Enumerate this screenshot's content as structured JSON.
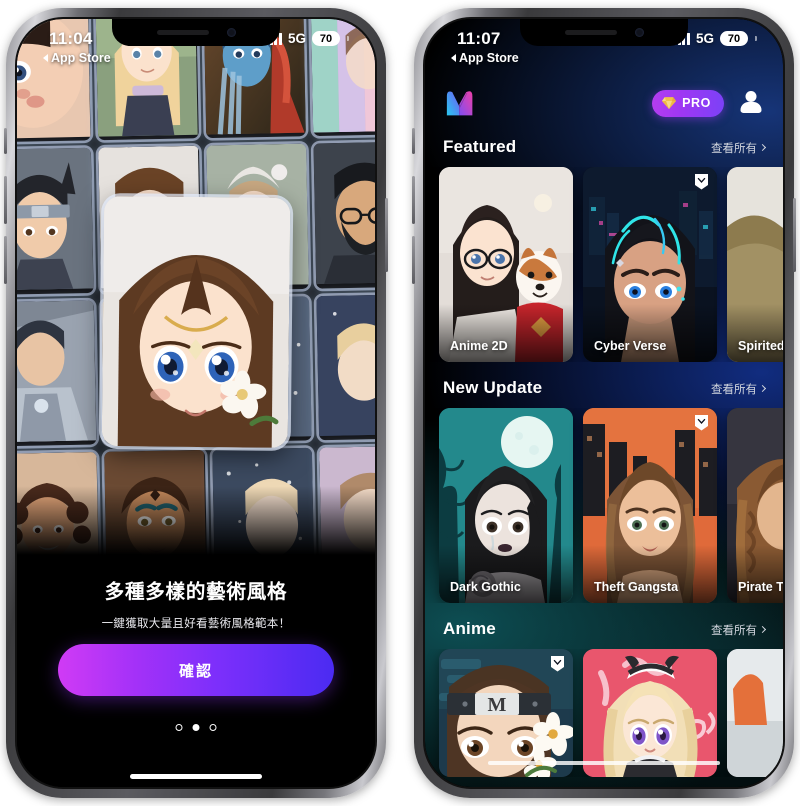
{
  "left_phone": {
    "status": {
      "time": "11:04",
      "network": "5G",
      "battery": "70",
      "back_label": "App Store"
    },
    "onboarding": {
      "title": "多種多樣的藝術風格",
      "subtitle": "一鍵獲取大量且好看藝術風格範本！",
      "cta_label": "確認",
      "page_dots": {
        "total": 3,
        "active_index": 1
      }
    },
    "collage": {
      "tiles": [
        "baby-portrait",
        "blonde-anime-girl",
        "blue-avatar-woman",
        "rainbow-strip",
        "ninja-headband-boy",
        "hero-anime-girl",
        "winter-child",
        "bearded-man-glasses",
        "armored-knight",
        "flower-crown-woman",
        "snow-princess",
        "galaxy-portrait",
        "curly-hair-woman",
        "bronze-warrior-queen",
        "frost-lady",
        "soft-pastel-face"
      ]
    }
  },
  "right_phone": {
    "status": {
      "time": "11:07",
      "network": "5G",
      "battery": "70",
      "back_label": "App Store"
    },
    "appbar": {
      "logo": "m-logo",
      "pro_label": "PRO",
      "gem": "diamond-icon",
      "avatar": "user-avatar-icon"
    },
    "sections": [
      {
        "title": "Featured",
        "more_label": "查看所有",
        "cards": [
          {
            "name": "Anime 2D",
            "badge": false,
            "theme": "anime2d"
          },
          {
            "name": "Cyber Verse",
            "badge": true,
            "theme": "cyber"
          },
          {
            "name": "Spirited",
            "badge": false,
            "theme": "spirited"
          }
        ]
      },
      {
        "title": "New Update",
        "more_label": "查看所有",
        "cards": [
          {
            "name": "Dark Gothic",
            "badge": false,
            "theme": "gothic"
          },
          {
            "name": "Theft Gangsta",
            "badge": true,
            "theme": "gangsta"
          },
          {
            "name": "Pirate T",
            "badge": false,
            "theme": "pirate"
          }
        ]
      },
      {
        "title": "Anime",
        "more_label": "查看所有",
        "cards": [
          {
            "name": "",
            "badge": true,
            "theme": "ninja"
          },
          {
            "name": "",
            "badge": false,
            "theme": "maid"
          },
          {
            "name": "",
            "badge": false,
            "theme": "street"
          }
        ]
      }
    ]
  },
  "colors": {
    "cta_start": "#d03bf5",
    "cta_end": "#4b2bf2",
    "pro_start": "#b33df0",
    "pro_end": "#7c41f7",
    "background": "#000000",
    "accent_blue": "#1e46a0",
    "accent_teal": "#105c62"
  }
}
